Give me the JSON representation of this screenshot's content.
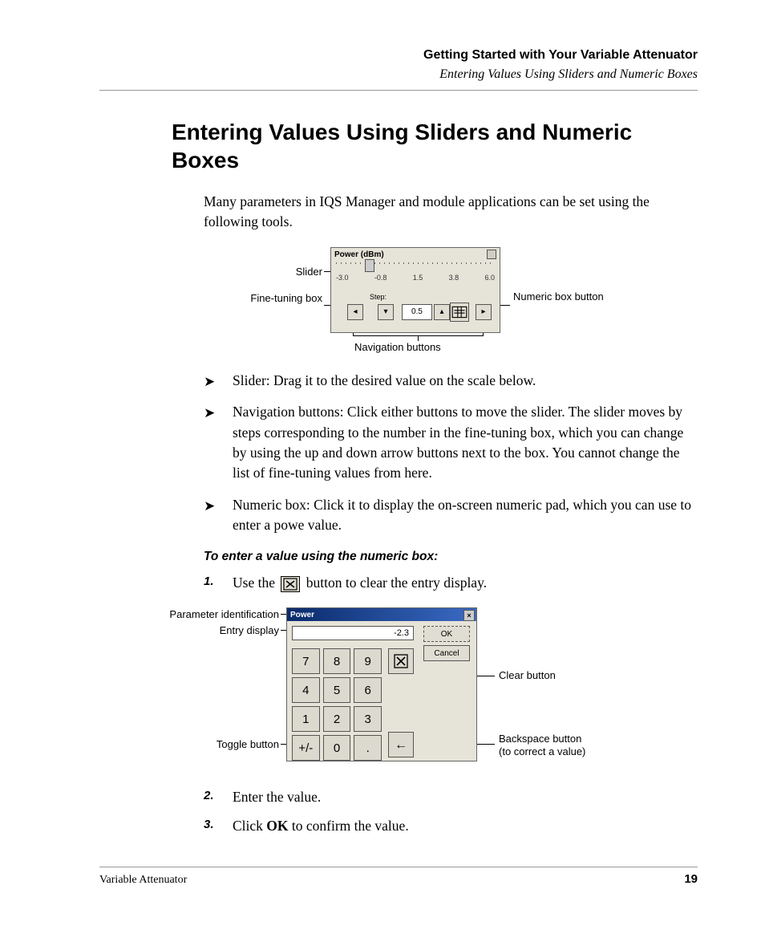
{
  "header": {
    "chapter": "Getting Started with Your Variable Attenuator",
    "sub": "Entering Values Using Sliders and Numeric Boxes"
  },
  "h1": "Entering Values Using Sliders and Numeric Boxes",
  "lead": "Many parameters in IQS Manager and module applications can be set using the following tools.",
  "fig1": {
    "title": "Power (dBm)",
    "ticks": [
      "-3.0",
      "-0.8",
      "1.5",
      "3.8",
      "6.0"
    ],
    "step_label": "Step:",
    "step_value": "0.5",
    "callouts": {
      "slider": "Slider",
      "fine": "Fine-tuning box",
      "numeric": "Numeric box button",
      "nav": "Navigation buttons"
    }
  },
  "bullets": [
    "Slider: Drag it to the desired value on the scale below.",
    "Navigation buttons: Click either buttons to move the slider. The slider moves by steps corresponding to the number in the fine-tuning box, which you can change by using the up and down arrow buttons next to the box. You cannot change the list of fine-tuning values from here.",
    "Numeric box: Click it to display the on-screen numeric pad, which you can use to enter a powe value."
  ],
  "proc_title": "To enter a value using the numeric box:",
  "steps": {
    "s1a": "Use the ",
    "s1b": " button to clear the entry display.",
    "s2": "Enter the value.",
    "s3a": "Click ",
    "s3b": "OK",
    "s3c": " to confirm the value."
  },
  "fig2": {
    "title": "Power",
    "entry": "-2.3",
    "ok": "OK",
    "cancel": "Cancel",
    "keys": [
      "7",
      "8",
      "9",
      "4",
      "5",
      "6",
      "1",
      "2",
      "3",
      "+/-",
      "0",
      "."
    ],
    "callouts": {
      "param": "Parameter identification",
      "entry": "Entry display",
      "toggle": "Toggle button",
      "clear": "Clear button",
      "back1": "Backspace button",
      "back2": "(to correct a value)"
    }
  },
  "footer": {
    "product": "Variable Attenuator",
    "page": "19"
  }
}
